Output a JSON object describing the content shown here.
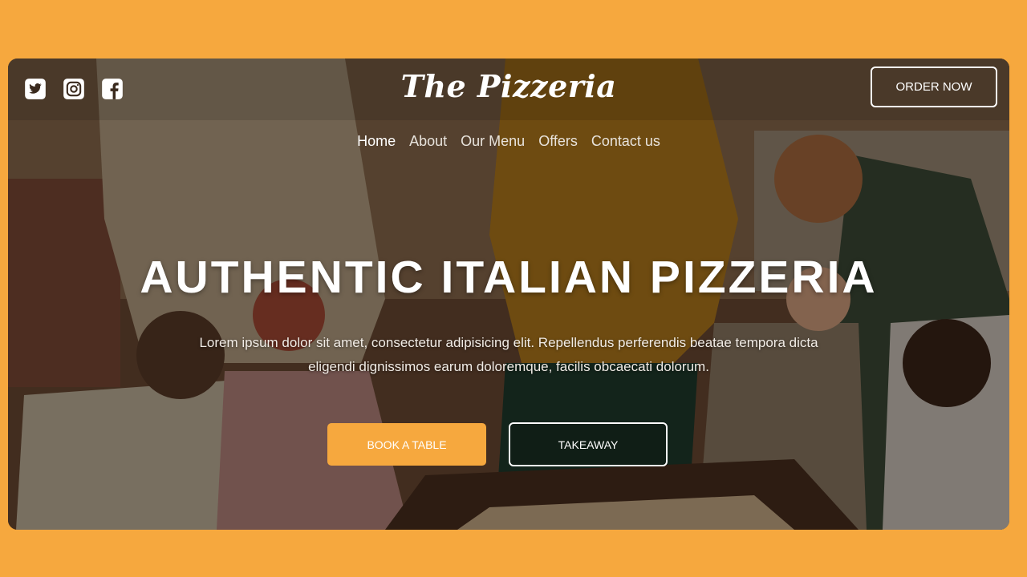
{
  "brand": {
    "name": "The Pizzeria"
  },
  "header": {
    "order_label": "ORDER NOW",
    "socials": [
      "twitter-icon",
      "instagram-icon",
      "facebook-icon"
    ]
  },
  "nav": {
    "items": [
      {
        "label": "Home",
        "active": true
      },
      {
        "label": "About"
      },
      {
        "label": "Our Menu"
      },
      {
        "label": "Offers"
      },
      {
        "label": "Contact us"
      }
    ]
  },
  "hero": {
    "headline": "AUTHENTIC ITALIAN PIZZERIA",
    "lede": "Lorem ipsum dolor sit amet, consectetur adipisicing elit. Repellendus perferendis beatae tempora dicta eligendi dignissimos earum doloremque, facilis obcaecati dolorum.",
    "book_label": "BOOK A TABLE",
    "takeaway_label": "TAKEAWAY"
  },
  "colors": {
    "accent": "#f6a83e",
    "text": "#ffffff"
  }
}
